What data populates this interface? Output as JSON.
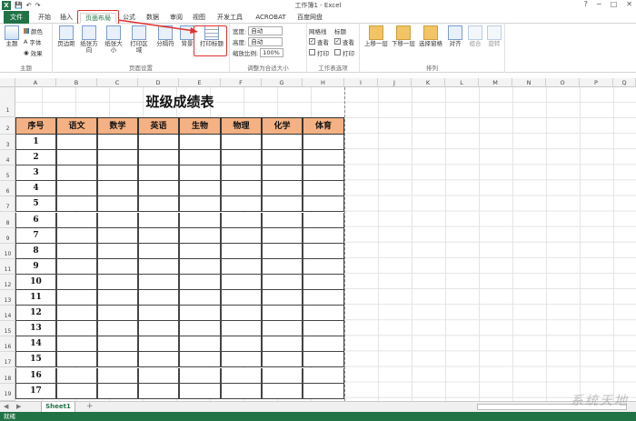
{
  "window": {
    "title": "工作簿1 - Excel"
  },
  "tabs": [
    {
      "label": "文件"
    },
    {
      "label": "开始"
    },
    {
      "label": "插入"
    },
    {
      "label": "页面布局"
    },
    {
      "label": "公式"
    },
    {
      "label": "数据"
    },
    {
      "label": "审阅"
    },
    {
      "label": "视图"
    },
    {
      "label": "开发工具"
    },
    {
      "label": "ACROBAT"
    },
    {
      "label": "百度网盘"
    }
  ],
  "ribbon": {
    "theme": {
      "label": "主题",
      "colors": "颜色",
      "fonts": "字体",
      "effects": "效果",
      "group": "主题"
    },
    "page_setup": {
      "margins": "页边距",
      "orientation": "纸张方向",
      "size": "纸张大小",
      "print_area": "打印区域",
      "breaks": "分隔符",
      "background": "背景",
      "print_titles": "打印标题",
      "group": "页面设置"
    },
    "scale": {
      "width_label": "宽度:",
      "width_value": "自动",
      "height_label": "高度:",
      "height_value": "自动",
      "scale_label": "缩放比例:",
      "scale_value": "100%",
      "group": "调整为合适大小"
    },
    "sheet_options": {
      "gridlines": "网格线",
      "headings": "标题",
      "view": "查看",
      "print": "打印",
      "group": "工作表选项"
    },
    "arrange": {
      "forward": "上移一层",
      "backward": "下移一层",
      "selection_pane": "选择窗格",
      "align": "对齐",
      "group_btn": "组合",
      "rotate": "旋转",
      "group": "排列"
    }
  },
  "columns": [
    "A",
    "B",
    "C",
    "D",
    "E",
    "F",
    "G",
    "H",
    "I",
    "J",
    "K",
    "L",
    "M",
    "N",
    "O",
    "P",
    "Q"
  ],
  "rows": [
    "1",
    "2",
    "3",
    "4",
    "5",
    "6",
    "7",
    "8",
    "9",
    "10",
    "11",
    "12",
    "13",
    "14",
    "15",
    "16",
    "17",
    "18",
    "19"
  ],
  "table": {
    "title": "班级成绩表",
    "headers": [
      "序号",
      "语文",
      "数学",
      "英语",
      "生物",
      "物理",
      "化学",
      "体育"
    ],
    "numbers": [
      "1",
      "2",
      "3",
      "4",
      "5",
      "6",
      "7",
      "8",
      "9",
      "10",
      "11",
      "12",
      "13",
      "14",
      "15",
      "16",
      "17"
    ]
  },
  "sheet": {
    "tab": "Sheet1",
    "add": "+"
  },
  "status": {
    "text": "就绪"
  },
  "watermark": "系统天地"
}
